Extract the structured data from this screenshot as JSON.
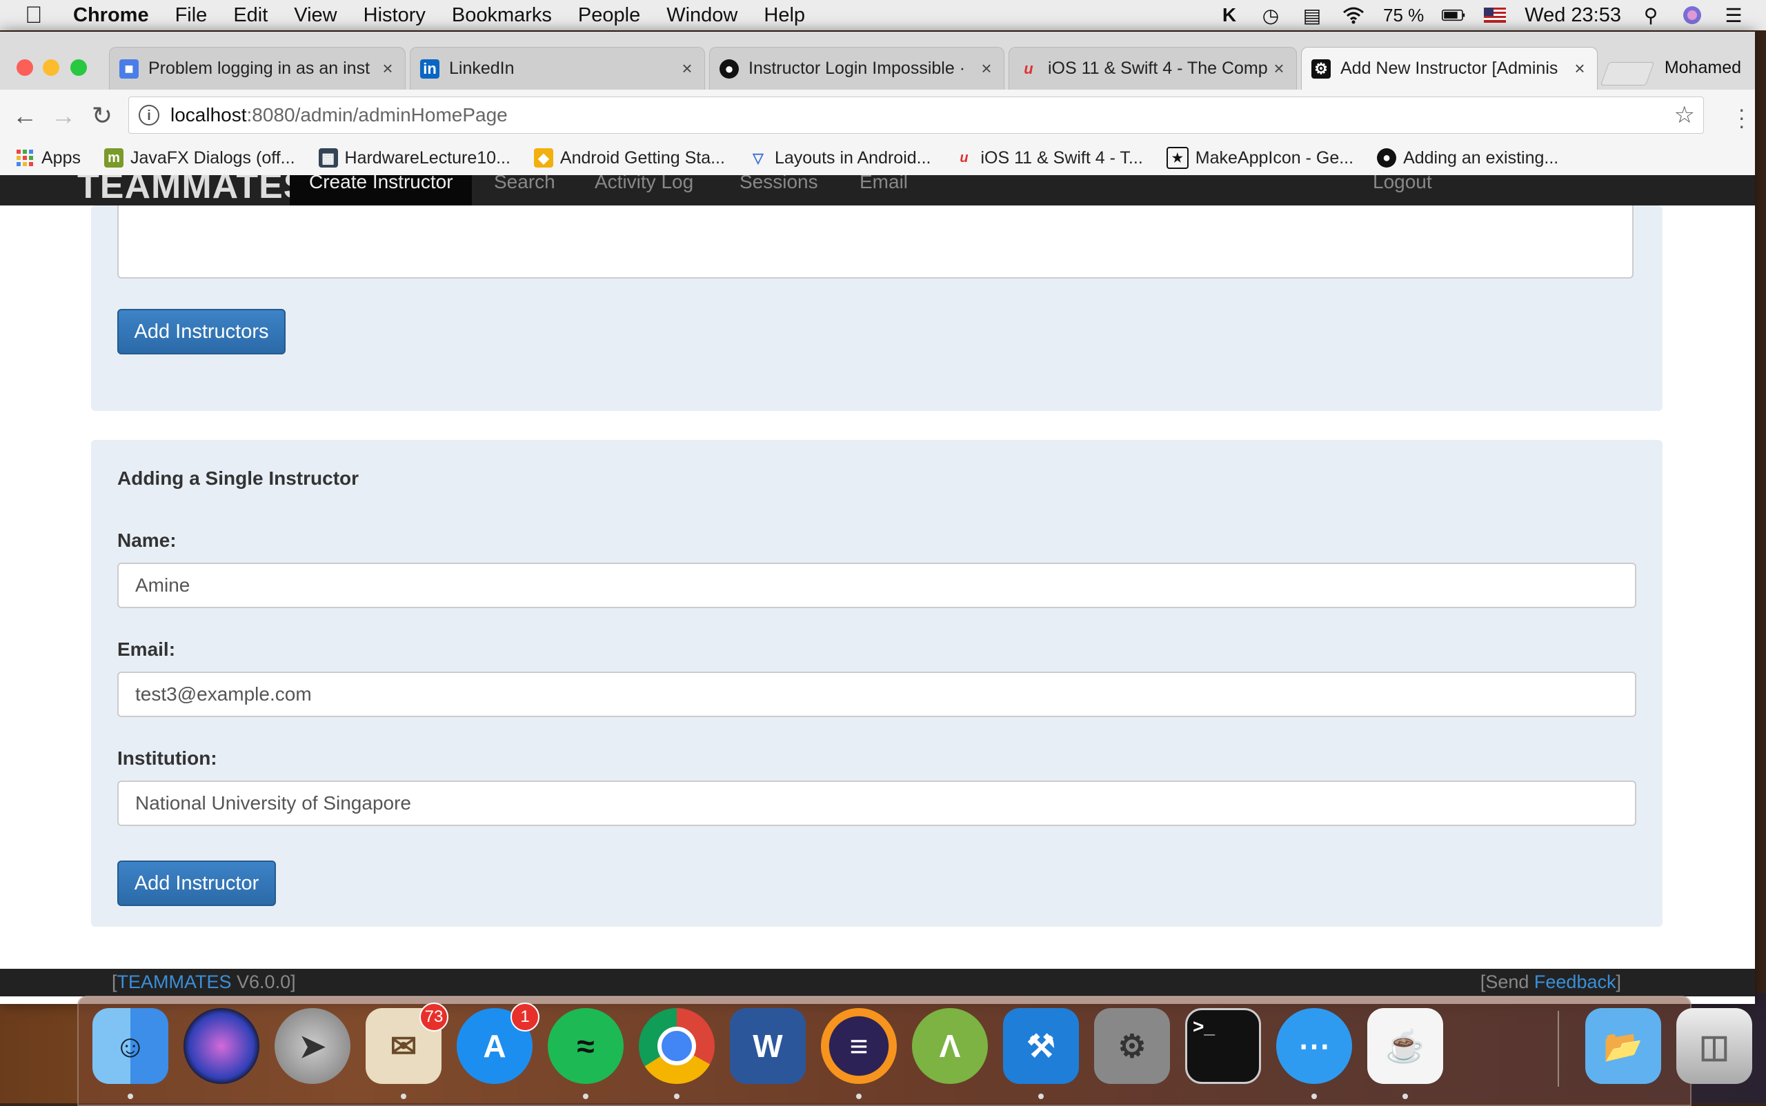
{
  "menubar": {
    "app_name": "Chrome",
    "menus": [
      "File",
      "Edit",
      "View",
      "History",
      "Bookmarks",
      "People",
      "Window",
      "Help"
    ],
    "battery": "75 %",
    "clock": "Wed 23:53"
  },
  "tabs": [
    {
      "label": "Problem logging in as an inst",
      "icon": "google-doc-icon"
    },
    {
      "label": "LinkedIn",
      "icon": "linkedin-icon"
    },
    {
      "label": "Instructor Login Impossible ·",
      "icon": "github-icon"
    },
    {
      "label": "iOS 11 & Swift 4 - The Comp",
      "icon": "udemy-icon"
    },
    {
      "label": "Add New Instructor [Adminis",
      "icon": "gear-icon"
    }
  ],
  "profile_name": "Mohamed",
  "address": {
    "host": "localhost",
    "path": ":8080/admin/adminHomePage"
  },
  "bookmarks": [
    {
      "label": "Apps",
      "icon": "apps-grid-icon"
    },
    {
      "label": "JavaFX Dialogs (off...",
      "icon": "m-icon"
    },
    {
      "label": "HardwareLecture10...",
      "icon": "document-icon"
    },
    {
      "label": "Android Getting Sta...",
      "icon": "android-studio-icon"
    },
    {
      "label": "Layouts in Android...",
      "icon": "vuforia-triangle-icon"
    },
    {
      "label": "iOS 11 & Swift 4 - T...",
      "icon": "udemy-icon"
    },
    {
      "label": "MakeAppIcon - Ge...",
      "icon": "star-box-icon"
    },
    {
      "label": "Adding an existing...",
      "icon": "github-icon"
    }
  ],
  "navbar": {
    "brand": "TEAMMATES",
    "items": [
      "Create Instructor",
      "Search",
      "Activity Log",
      "Sessions",
      "Email"
    ],
    "logout": "Logout"
  },
  "multi_panel": {
    "button": "Add Instructors"
  },
  "single_panel": {
    "title": "Adding a Single Instructor",
    "name_label": "Name:",
    "name_value": "Amine",
    "email_label": "Email:",
    "email_value": "test3@example.com",
    "institution_label": "Institution:",
    "institution_value": "National University of Singapore",
    "button": "Add Instructor"
  },
  "footer": {
    "left_open": "[",
    "left_link": "TEAMMATES",
    "left_version": " V6.0.0]",
    "right_open": "[Send ",
    "right_link": "Feedback",
    "right_close": "]"
  },
  "dock": {
    "mail_badge": "73",
    "appstore_badge": "1"
  }
}
